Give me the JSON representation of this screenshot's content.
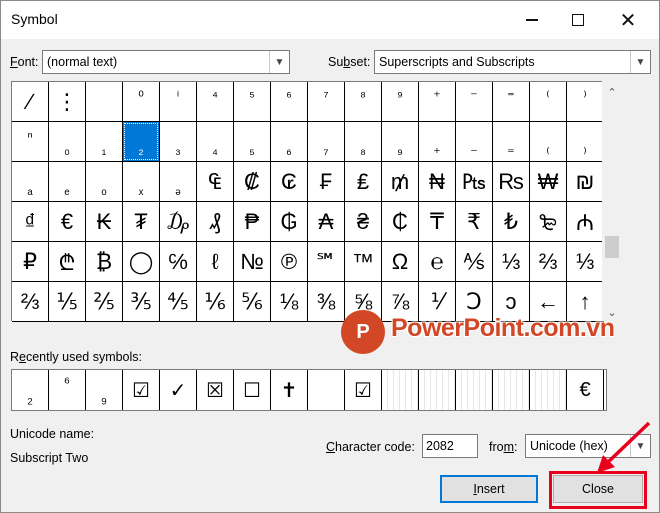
{
  "window": {
    "title": "Symbol",
    "minimize_glyph": "",
    "close_glyph": "✕"
  },
  "font": {
    "label_mnemonic": "F",
    "label_rest": "ont:",
    "value": "(normal text)"
  },
  "subset": {
    "label_pre": "Su",
    "label_mnemonic": "b",
    "label_rest": "set:",
    "value": "Superscripts and Subscripts"
  },
  "grid": {
    "rows": [
      [
        "∕",
        "⋮",
        "",
        "⁰",
        "ⁱ",
        "⁴",
        "⁵",
        "⁶",
        "⁷",
        "⁸",
        "⁹",
        "⁺",
        "⁻",
        "⁼",
        "⁽",
        "⁾"
      ],
      [
        "ⁿ",
        "₀",
        "₁",
        "₂",
        "₃",
        "₄",
        "₅",
        "₆",
        "₇",
        "₈",
        "₉",
        "₊",
        "₋",
        "₌",
        "₍",
        "₎"
      ],
      [
        "ₐ",
        "ₑ",
        "ₒ",
        "ₓ",
        "ₔ",
        "₠",
        "₡",
        "₢",
        "₣",
        "₤",
        "₥",
        "₦",
        "₧",
        "₨",
        "₩",
        "₪"
      ],
      [
        "₫",
        "€",
        "₭",
        "₮",
        "₯",
        "₰",
        "₱",
        "₲",
        "₳",
        "₴",
        "₵",
        "₸",
        "₹",
        "₺",
        "₻",
        "₼"
      ],
      [
        "₽",
        "₾",
        "₿",
        "◯",
        "℅",
        "ℓ",
        "№",
        "℗",
        "℠",
        "™",
        "Ω",
        "℮",
        "⅍",
        "⅓",
        "⅔",
        "⅓"
      ],
      [
        "⅔",
        "⅕",
        "⅖",
        "⅗",
        "⅘",
        "⅙",
        "⅚",
        "⅛",
        "⅜",
        "⅝",
        "⅞",
        "⅟",
        "Ↄ",
        "ↄ",
        "←",
        "↑"
      ]
    ],
    "selected": "₂"
  },
  "recent": {
    "label_pre": "R",
    "label_mnemonic": "e",
    "label_rest": "cently used symbols:",
    "items": [
      "₂",
      "⁶",
      "₉",
      "☑",
      "✓",
      "☒",
      "☐",
      "✝",
      "",
      "☑",
      "",
      "",
      "",
      "",
      "",
      "€"
    ]
  },
  "unicode": {
    "name_label": "Unicode name:",
    "name_value": "Subscript Two"
  },
  "charcode": {
    "label_mnemonic": "C",
    "label_rest": "haracter code:",
    "value": "2082",
    "from_label_pre": "fro",
    "from_label_mnemonic": "m",
    "from_label_rest": ":",
    "from_value": "Unicode (hex)"
  },
  "buttons": {
    "insert_mnemonic": "I",
    "insert_rest": "nsert",
    "close": "Close"
  },
  "watermark": {
    "logo_letter": "P",
    "text": "PowerPoint.com.vn"
  },
  "colors": {
    "selection": "#0078d7",
    "annotation": "#e8001c",
    "watermark": "#d24726"
  }
}
